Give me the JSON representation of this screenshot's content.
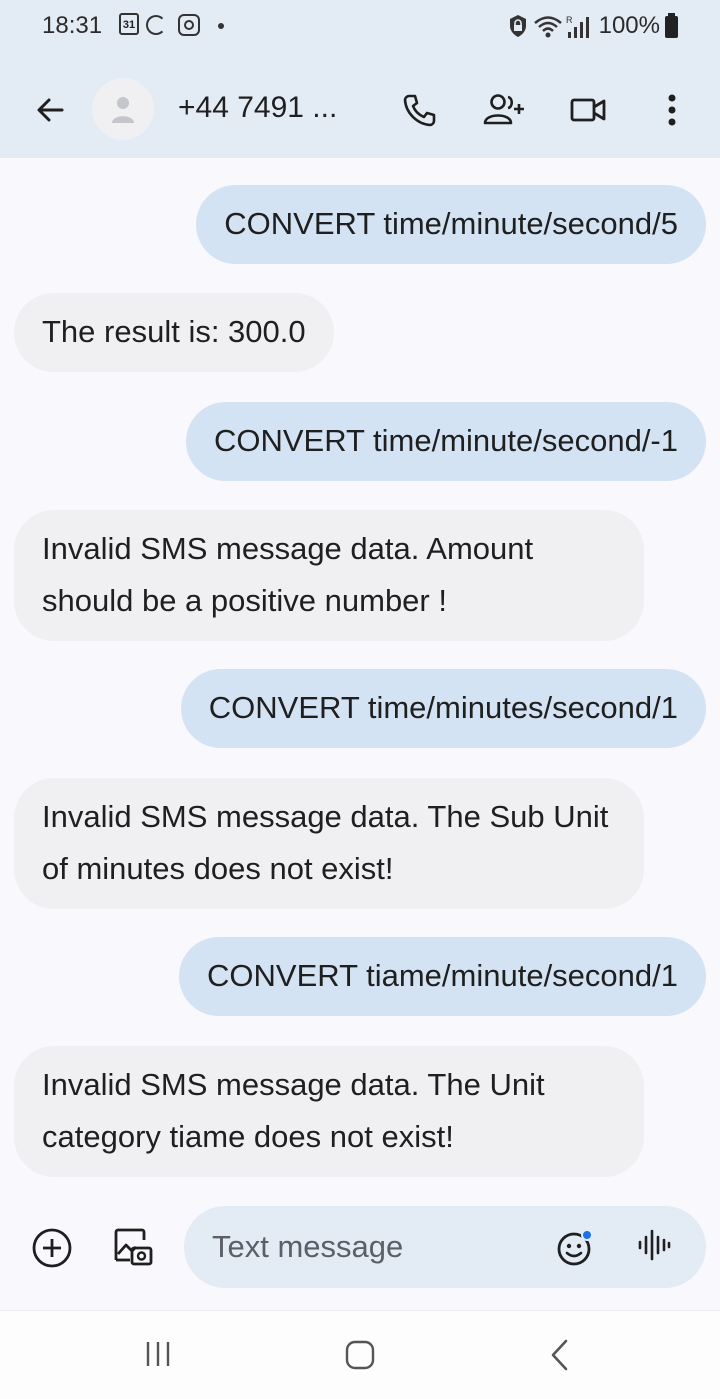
{
  "status_bar": {
    "time": "18:31",
    "calendar_day": "31",
    "battery": "100%"
  },
  "header": {
    "contact": "+44 7491 ..."
  },
  "messages": [
    {
      "direction": "outgoing",
      "text": "CONVERT time/minute/second/5"
    },
    {
      "direction": "incoming",
      "text": "The result is: 300.0"
    },
    {
      "direction": "outgoing",
      "text": "CONVERT time/minute/second/-1"
    },
    {
      "direction": "incoming",
      "text": "Invalid SMS message data. Amount should be a positive number !"
    },
    {
      "direction": "outgoing",
      "text": "CONVERT time/minutes/second/1"
    },
    {
      "direction": "incoming",
      "text": "Invalid SMS message data. The Sub Unit of minutes does not exist!"
    },
    {
      "direction": "outgoing",
      "text": "CONVERT tiame/minute/second/1"
    },
    {
      "direction": "incoming",
      "text": "Invalid SMS message data. The Unit category tiame does not exist!"
    }
  ],
  "composer": {
    "placeholder": "Text message"
  },
  "colors": {
    "header_bg": "#e3ebf4",
    "outgoing_bubble": "#d3e3f4",
    "incoming_bubble": "#f0f0f3",
    "emoji_badge": "#1a73e8"
  },
  "icons": {
    "back": "arrow-left-icon",
    "avatar": "person-icon",
    "call": "phone-icon",
    "add_contact": "add-person-icon",
    "video": "video-camera-icon",
    "more": "more-vert-icon",
    "attach": "plus-circle-icon",
    "gallery": "gallery-icon",
    "emoji": "emoji-icon",
    "voice": "voice-wave-icon"
  }
}
